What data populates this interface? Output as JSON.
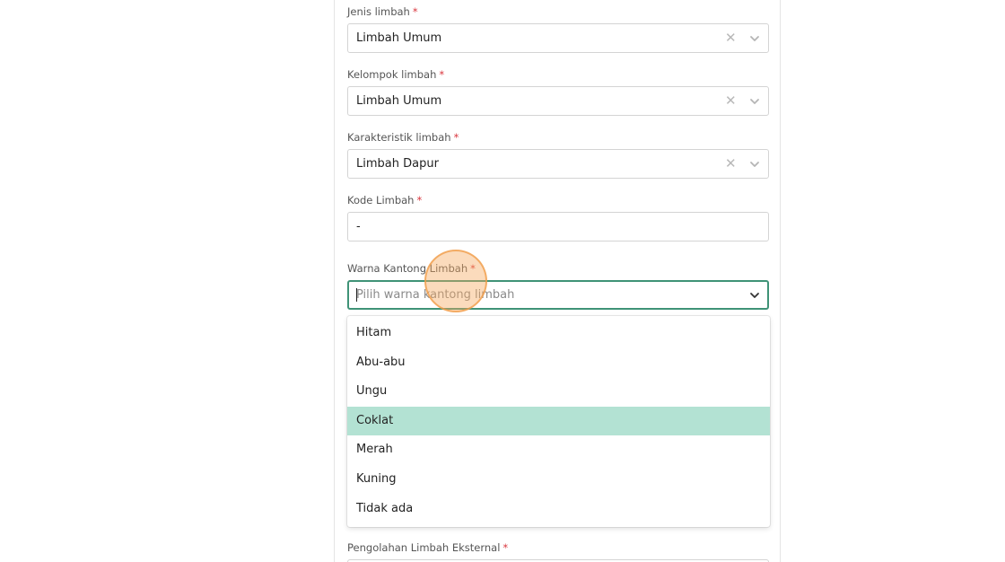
{
  "form": {
    "jenis_limbah": {
      "label": "Jenis limbah",
      "value": "Limbah Umum"
    },
    "kelompok_limbah": {
      "label": "Kelompok limbah",
      "value": "Limbah Umum"
    },
    "karakteristik_limbah": {
      "label": "Karakteristik limbah",
      "value": "Limbah Dapur"
    },
    "kode_limbah": {
      "label": "Kode Limbah",
      "value": "-"
    },
    "warna_kantong": {
      "label": "Warna Kantong Limbah",
      "placeholder": "Pilih warna kantong limbah"
    },
    "pengolahan_eksternal": {
      "label": "Pengolahan Limbah Eksternal"
    },
    "required_mark": "*"
  },
  "dropdown": {
    "options": [
      "Hitam",
      "Abu-abu",
      "Ungu",
      "Coklat",
      "Merah",
      "Kuning",
      "Tidak ada"
    ],
    "highlighted": "Coklat"
  },
  "icons": {
    "clear": "close-icon",
    "expand": "chevron-down-icon"
  },
  "colors": {
    "focus_border": "#3f9377",
    "highlight": "#b3e2d3",
    "required": "#d9363e"
  }
}
